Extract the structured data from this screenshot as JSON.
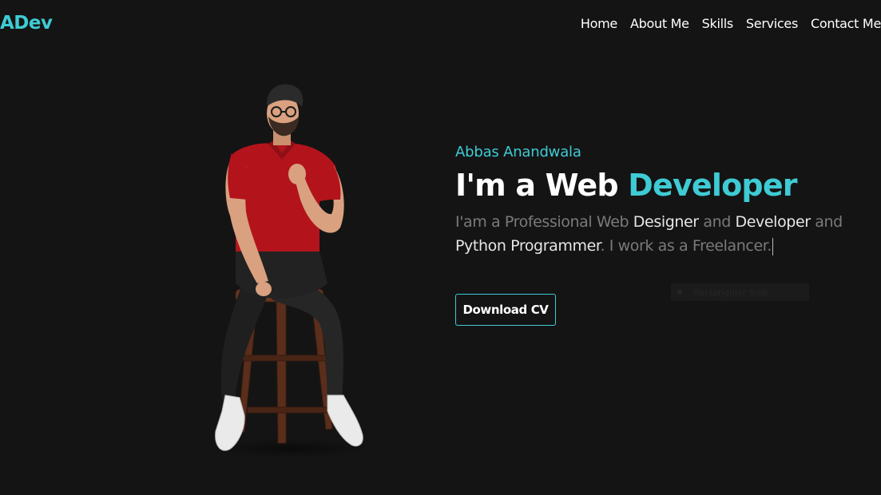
{
  "brand": {
    "logo": "ADev",
    "accent_color": "#3fcbd4"
  },
  "nav": {
    "items": [
      {
        "label": "Home"
      },
      {
        "label": "About Me"
      },
      {
        "label": "Skills"
      },
      {
        "label": "Services"
      },
      {
        "label": "Contact Me"
      }
    ]
  },
  "hero": {
    "name": "Abbas Anandwala",
    "heading_prefix": "I'm a Web ",
    "heading_accent": "Developer",
    "desc": {
      "p1": "I'am a Professional Web ",
      "s1": "Designer",
      "p2": " and ",
      "s2": "Developer",
      "p3": " and ",
      "s3": "Python Programmer",
      "p4": ". I work as a Freelancer."
    },
    "button_label": "Download CV",
    "image_subject": "person-sitting-on-stool"
  },
  "overlay": {
    "tooltip_text": "Rectangular Snip"
  },
  "colors": {
    "background": "#141414",
    "text": "#ffffff",
    "muted": "#7a7a7a",
    "shirt": "#b3141c"
  }
}
